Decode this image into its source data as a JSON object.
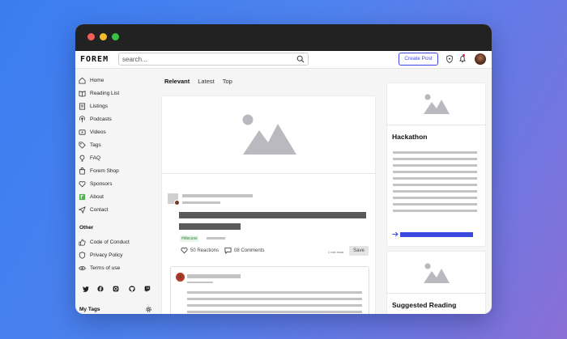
{
  "header": {
    "logo": "FOREM",
    "search_placeholder": "search...",
    "create_post_label": "Create Post"
  },
  "sidebar": {
    "items": [
      {
        "label": "Home",
        "icon": "home-icon"
      },
      {
        "label": "Reading List",
        "icon": "book-icon"
      },
      {
        "label": "Listings",
        "icon": "listings-icon"
      },
      {
        "label": "Podcasts",
        "icon": "podcast-icon"
      },
      {
        "label": "Videos",
        "icon": "video-icon"
      },
      {
        "label": "Tags",
        "icon": "tag-icon"
      },
      {
        "label": "FAQ",
        "icon": "lightbulb-icon"
      },
      {
        "label": "Forem Shop",
        "icon": "shop-icon"
      },
      {
        "label": "Sponsors",
        "icon": "heart-icon"
      },
      {
        "label": "About",
        "icon": "forem-icon"
      },
      {
        "label": "Contact",
        "icon": "send-icon"
      }
    ],
    "other_heading": "Other",
    "other_items": [
      {
        "label": "Code of Conduct",
        "icon": "thumbs-up-icon"
      },
      {
        "label": "Privacy Policy",
        "icon": "shield-icon"
      },
      {
        "label": "Terms of use",
        "icon": "eye-icon"
      }
    ],
    "social": [
      "twitter-icon",
      "facebook-icon",
      "instagram-icon",
      "github-icon",
      "twitch-icon"
    ],
    "my_tags_heading": "My Tags"
  },
  "feed": {
    "tabs": [
      "Relevant",
      "Latest",
      "Top"
    ],
    "active_tab": "Relevant",
    "post": {
      "tag": "#discuss",
      "reactions": "50 Reactions",
      "comments": "08 Comments",
      "read_time": "1 min read",
      "save_label": "Save"
    }
  },
  "right": {
    "card1_title": "Hackathon",
    "card2_title": "Suggested Reading"
  },
  "colors": {
    "accent": "#3b49df",
    "background_gradient_start": "#3a7df0",
    "background_gradient_end": "#8a6fd6",
    "placeholder_gray": "#c3c3c3",
    "tag_green": "#2e7d32"
  }
}
